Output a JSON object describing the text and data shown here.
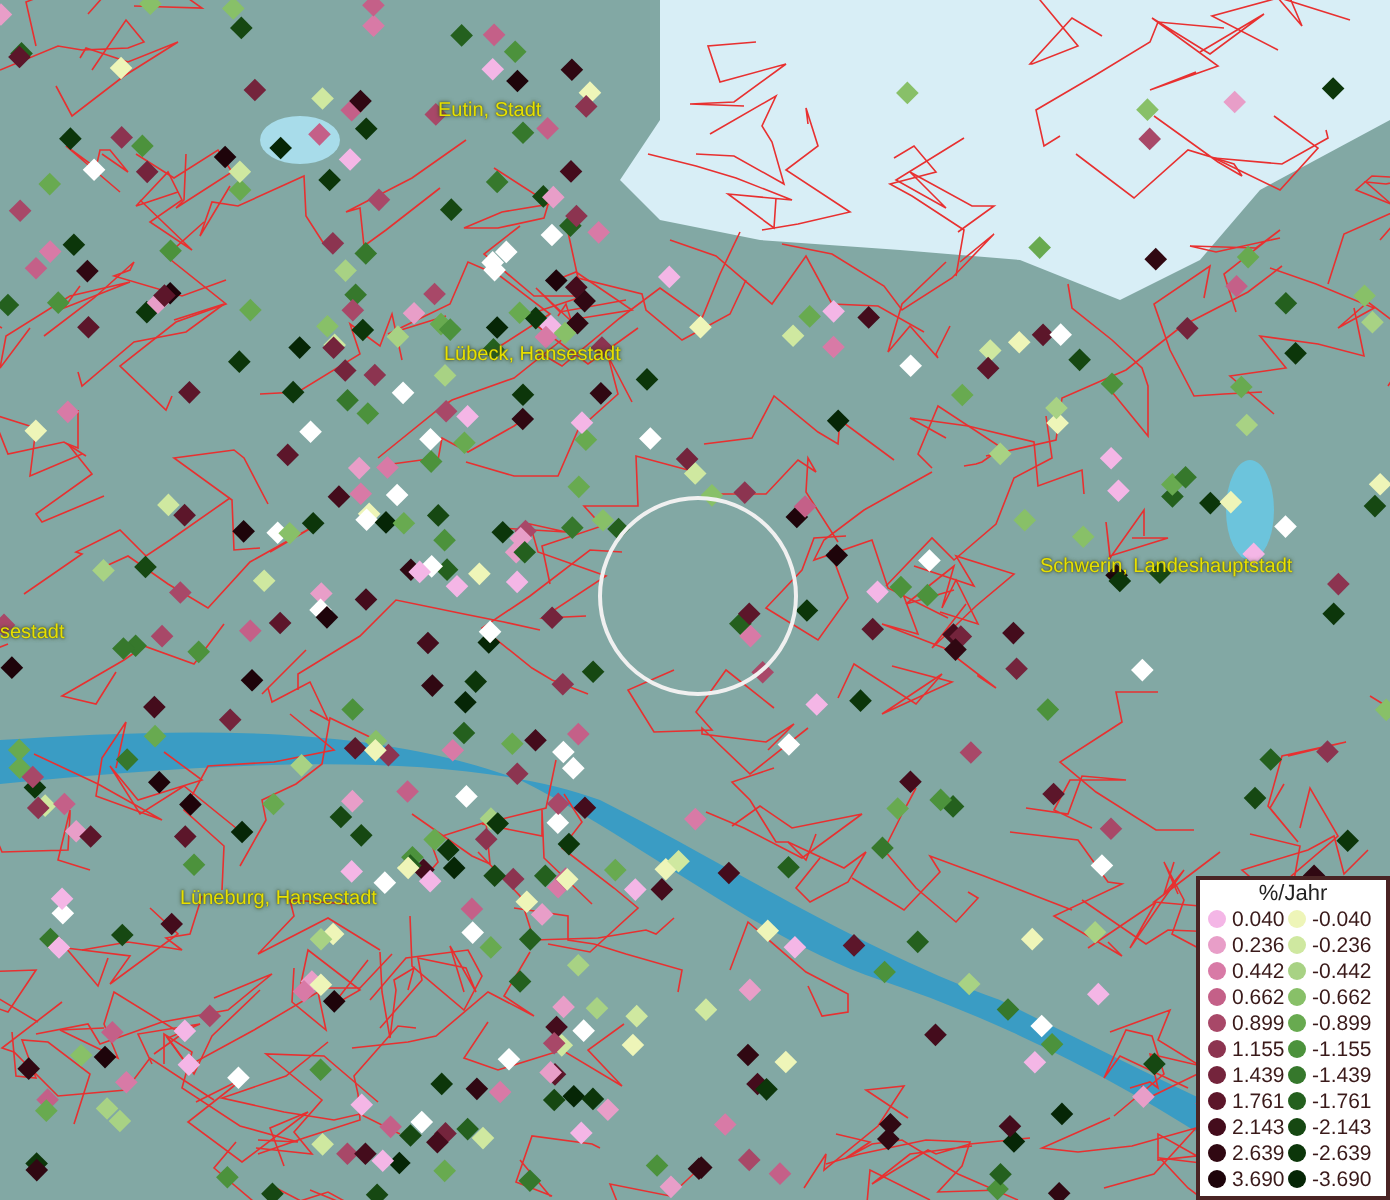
{
  "map": {
    "places": [
      {
        "name": "Eutin, Stadt"
      },
      {
        "name": "Lübeck, Hansestadt"
      },
      {
        "name": "Schwerin, Landeshauptstadt"
      },
      {
        "name": "sestadt"
      },
      {
        "name": "Lüneburg, Hansestadt"
      }
    ]
  },
  "legend": {
    "title": "%/Jahr",
    "items": [
      {
        "label": "0.040",
        "color": "#f4b6e6"
      },
      {
        "label": "-0.040",
        "color": "#eef5b8"
      },
      {
        "label": "0.236",
        "color": "#e89ec8"
      },
      {
        "label": "-0.236",
        "color": "#cfe8a0"
      },
      {
        "label": "0.442",
        "color": "#d87aa6"
      },
      {
        "label": "-0.442",
        "color": "#a8d284"
      },
      {
        "label": "0.662",
        "color": "#c46088"
      },
      {
        "label": "-0.662",
        "color": "#88c068"
      },
      {
        "label": "0.899",
        "color": "#a84868"
      },
      {
        "label": "-0.899",
        "color": "#68aa50"
      },
      {
        "label": "1.155",
        "color": "#8c3450"
      },
      {
        "label": "-1.155",
        "color": "#4c923c"
      },
      {
        "label": "1.439",
        "color": "#74243c"
      },
      {
        "label": "-1.439",
        "color": "#36782c"
      },
      {
        "label": "1.761",
        "color": "#5c162a"
      },
      {
        "label": "-1.761",
        "color": "#24601e"
      },
      {
        "label": "2.143",
        "color": "#440c1c"
      },
      {
        "label": "-2.143",
        "color": "#164812"
      },
      {
        "label": "2.639",
        "color": "#300812"
      },
      {
        "label": "-2.639",
        "color": "#0c360a"
      },
      {
        "label": "3.690",
        "color": "#1e040a"
      },
      {
        "label": "-3.690",
        "color": "#062606"
      }
    ]
  }
}
